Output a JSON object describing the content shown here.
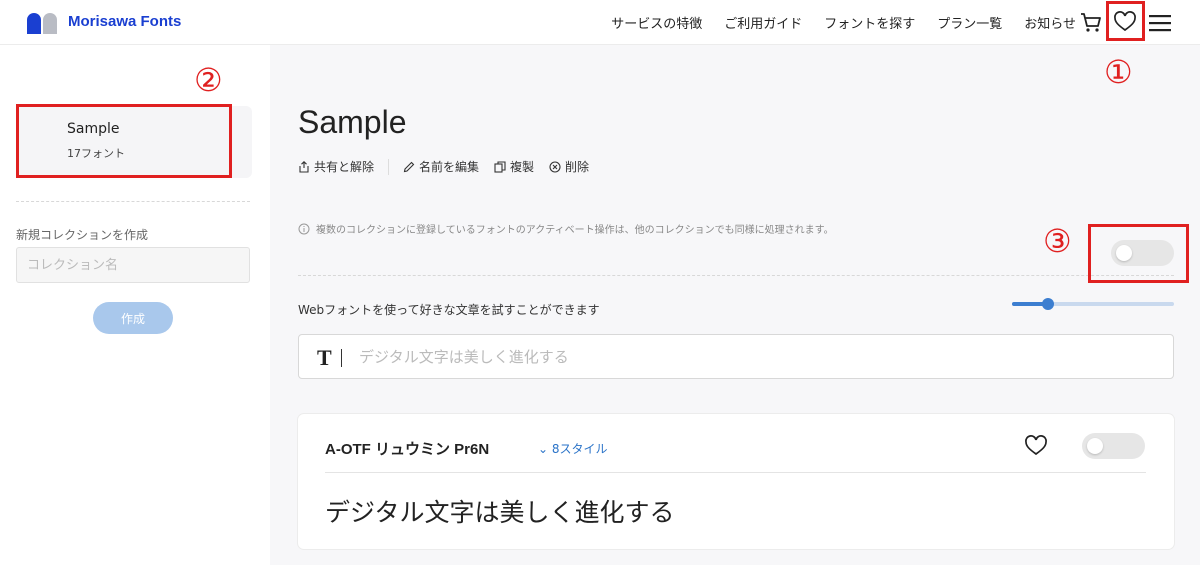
{
  "header": {
    "logo_text": "Morisawa Fonts",
    "nav": [
      "サービスの特徴",
      "ご利用ガイド",
      "フォントを探す",
      "プラン一覧",
      "お知らせ"
    ],
    "icons": {
      "cart": "cart-icon",
      "favorite": "heart-icon",
      "menu": "menu-icon"
    },
    "brand_color": "#1a3fd1"
  },
  "sidebar": {
    "collection": {
      "name": "Sample",
      "count": "17フォント"
    },
    "new_label": "新規コレクションを作成",
    "new_placeholder": "コレクション名",
    "create_button": "作成"
  },
  "main": {
    "title": "Sample",
    "actions": {
      "share": "共有と解除",
      "rename": "名前を編集",
      "duplicate": "複製",
      "delete": "削除"
    },
    "info_text": "複数のコレクションに登録しているフォントのアクティベート操作は、他のコレクションでも同様に処理されます。",
    "activate_all_on": false,
    "webfont_label": "Webフォントを使って好きな文章を試すことができます",
    "size_slider_fraction": 0.22,
    "preview_placeholder": "デジタル文字は美しく進化する",
    "font_card": {
      "name": "A-OTF リュウミン Pr6N",
      "styles": "8スタイル",
      "active": false,
      "sample": "デジタル文字は美しく進化する"
    }
  },
  "annotations": {
    "one": "①",
    "two": "②",
    "three": "③",
    "color": "#e02020"
  }
}
